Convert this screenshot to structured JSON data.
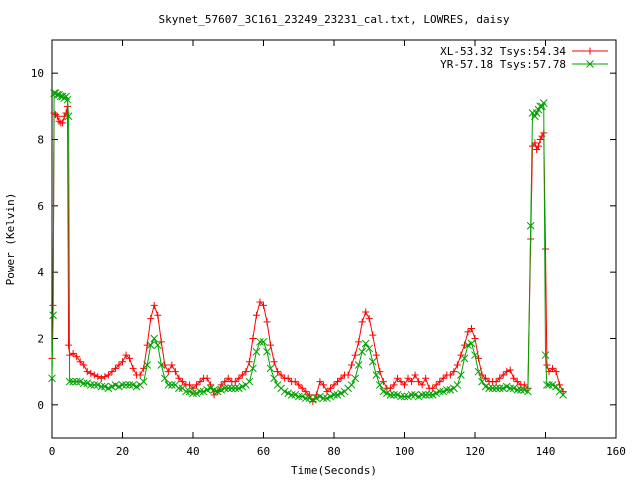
{
  "chart_data": {
    "type": "line",
    "title": "Skynet_57607_3C161_23249_23231_cal.txt, LOWRES, daisy",
    "xlabel": "Time(Seconds)",
    "ylabel": "Power (Kelvin)",
    "xlim": [
      0,
      160
    ],
    "ylim": [
      -1,
      11
    ],
    "xticks": [
      0,
      20,
      40,
      60,
      80,
      100,
      120,
      140,
      160
    ],
    "yticks": [
      0,
      2,
      4,
      6,
      8,
      10
    ],
    "grid": false,
    "legend_position": "top-right",
    "series": [
      {
        "name": "XL-53.32 Tsys:54.34",
        "color": "#ff0000",
        "marker": "plus",
        "points": [
          [
            0.0,
            1.4
          ],
          [
            0.3,
            3.0
          ],
          [
            0.6,
            8.8
          ],
          [
            1.0,
            8.75
          ],
          [
            1.5,
            8.7
          ],
          [
            2.0,
            8.55
          ],
          [
            2.5,
            8.5
          ],
          [
            3.0,
            8.5
          ],
          [
            3.5,
            8.7
          ],
          [
            4.0,
            8.8
          ],
          [
            4.4,
            9.0
          ],
          [
            4.7,
            1.8
          ],
          [
            5.0,
            1.5
          ],
          [
            6.0,
            1.55
          ],
          [
            7.0,
            1.45
          ],
          [
            8.0,
            1.3
          ],
          [
            9.0,
            1.2
          ],
          [
            10.0,
            1.0
          ],
          [
            11.0,
            0.95
          ],
          [
            12.0,
            0.9
          ],
          [
            13.0,
            0.85
          ],
          [
            14.0,
            0.8
          ],
          [
            15.0,
            0.85
          ],
          [
            16.0,
            0.9
          ],
          [
            17.0,
            1.0
          ],
          [
            18.0,
            1.1
          ],
          [
            19.0,
            1.2
          ],
          [
            20.0,
            1.3
          ],
          [
            21.0,
            1.5
          ],
          [
            22.0,
            1.4
          ],
          [
            23.0,
            1.1
          ],
          [
            24.0,
            0.9
          ],
          [
            25.0,
            0.9
          ],
          [
            26.0,
            1.1
          ],
          [
            27.0,
            1.8
          ],
          [
            28.0,
            2.6
          ],
          [
            29.0,
            3.0
          ],
          [
            30.0,
            2.7
          ],
          [
            31.0,
            1.9
          ],
          [
            32.0,
            1.2
          ],
          [
            33.0,
            1.0
          ],
          [
            34.0,
            1.2
          ],
          [
            35.0,
            1.0
          ],
          [
            36.0,
            0.8
          ],
          [
            37.0,
            0.7
          ],
          [
            38.0,
            0.6
          ],
          [
            39.0,
            0.6
          ],
          [
            40.0,
            0.5
          ],
          [
            41.0,
            0.6
          ],
          [
            42.0,
            0.7
          ],
          [
            43.0,
            0.8
          ],
          [
            44.0,
            0.8
          ],
          [
            45.0,
            0.6
          ],
          [
            46.0,
            0.3
          ],
          [
            47.0,
            0.4
          ],
          [
            48.0,
            0.6
          ],
          [
            49.0,
            0.7
          ],
          [
            50.0,
            0.8
          ],
          [
            51.0,
            0.7
          ],
          [
            52.0,
            0.7
          ],
          [
            53.0,
            0.8
          ],
          [
            54.0,
            0.9
          ],
          [
            55.0,
            1.0
          ],
          [
            56.0,
            1.3
          ],
          [
            57.0,
            2.0
          ],
          [
            58.0,
            2.7
          ],
          [
            59.0,
            3.1
          ],
          [
            60.0,
            3.0
          ],
          [
            61.0,
            2.5
          ],
          [
            62.0,
            1.8
          ],
          [
            63.0,
            1.3
          ],
          [
            64.0,
            1.0
          ],
          [
            65.0,
            0.9
          ],
          [
            66.0,
            0.8
          ],
          [
            67.0,
            0.8
          ],
          [
            68.0,
            0.7
          ],
          [
            69.0,
            0.7
          ],
          [
            70.0,
            0.6
          ],
          [
            71.0,
            0.5
          ],
          [
            72.0,
            0.4
          ],
          [
            73.0,
            0.3
          ],
          [
            74.0,
            0.1
          ],
          [
            75.0,
            0.3
          ],
          [
            76.0,
            0.7
          ],
          [
            77.0,
            0.6
          ],
          [
            78.0,
            0.4
          ],
          [
            79.0,
            0.5
          ],
          [
            80.0,
            0.6
          ],
          [
            81.0,
            0.7
          ],
          [
            82.0,
            0.8
          ],
          [
            83.0,
            0.9
          ],
          [
            84.0,
            0.9
          ],
          [
            85.0,
            1.2
          ],
          [
            86.0,
            1.5
          ],
          [
            87.0,
            1.9
          ],
          [
            88.0,
            2.5
          ],
          [
            89.0,
            2.8
          ],
          [
            90.0,
            2.6
          ],
          [
            91.0,
            2.1
          ],
          [
            92.0,
            1.5
          ],
          [
            93.0,
            1.0
          ],
          [
            94.0,
            0.7
          ],
          [
            95.0,
            0.5
          ],
          [
            96.0,
            0.5
          ],
          [
            97.0,
            0.6
          ],
          [
            98.0,
            0.8
          ],
          [
            99.0,
            0.7
          ],
          [
            100.0,
            0.6
          ],
          [
            101.0,
            0.8
          ],
          [
            102.0,
            0.7
          ],
          [
            103.0,
            0.9
          ],
          [
            104.0,
            0.7
          ],
          [
            105.0,
            0.6
          ],
          [
            106.0,
            0.8
          ],
          [
            107.0,
            0.5
          ],
          [
            108.0,
            0.5
          ],
          [
            109.0,
            0.6
          ],
          [
            110.0,
            0.7
          ],
          [
            111.0,
            0.8
          ],
          [
            112.0,
            0.9
          ],
          [
            113.0,
            0.9
          ],
          [
            114.0,
            1.0
          ],
          [
            115.0,
            1.2
          ],
          [
            116.0,
            1.5
          ],
          [
            117.0,
            1.8
          ],
          [
            118.0,
            2.2
          ],
          [
            119.0,
            2.3
          ],
          [
            120.0,
            2.0
          ],
          [
            121.0,
            1.4
          ],
          [
            122.0,
            0.9
          ],
          [
            123.0,
            0.8
          ],
          [
            124.0,
            0.7
          ],
          [
            125.0,
            0.7
          ],
          [
            126.0,
            0.7
          ],
          [
            127.0,
            0.8
          ],
          [
            128.0,
            0.9
          ],
          [
            129.0,
            1.0
          ],
          [
            130.0,
            1.05
          ],
          [
            131.0,
            0.8
          ],
          [
            132.0,
            0.7
          ],
          [
            133.0,
            0.6
          ],
          [
            134.0,
            0.6
          ],
          [
            135.0,
            0.5
          ],
          [
            135.8,
            5.0
          ],
          [
            136.3,
            7.8
          ],
          [
            137.0,
            7.9
          ],
          [
            137.5,
            7.7
          ],
          [
            138.0,
            7.8
          ],
          [
            138.5,
            8.0
          ],
          [
            139.0,
            8.1
          ],
          [
            139.5,
            8.2
          ],
          [
            140.0,
            4.7
          ],
          [
            140.4,
            1.2
          ],
          [
            141.0,
            1.0
          ],
          [
            142.0,
            1.1
          ],
          [
            143.0,
            1.0
          ],
          [
            144.0,
            0.6
          ],
          [
            145.0,
            0.4
          ]
        ]
      },
      {
        "name": "YR-57.18 Tsys:57.78",
        "color": "#00a000",
        "marker": "cross",
        "points": [
          [
            0.0,
            0.8
          ],
          [
            0.3,
            2.7
          ],
          [
            0.6,
            9.4
          ],
          [
            1.0,
            9.4
          ],
          [
            1.5,
            9.35
          ],
          [
            2.0,
            9.35
          ],
          [
            2.5,
            9.3
          ],
          [
            3.0,
            9.3
          ],
          [
            3.5,
            9.25
          ],
          [
            4.0,
            9.3
          ],
          [
            4.4,
            9.2
          ],
          [
            4.7,
            8.7
          ],
          [
            5.0,
            0.7
          ],
          [
            6.0,
            0.7
          ],
          [
            7.0,
            0.7
          ],
          [
            8.0,
            0.7
          ],
          [
            9.0,
            0.65
          ],
          [
            10.0,
            0.65
          ],
          [
            11.0,
            0.6
          ],
          [
            12.0,
            0.6
          ],
          [
            13.0,
            0.6
          ],
          [
            14.0,
            0.55
          ],
          [
            15.0,
            0.55
          ],
          [
            16.0,
            0.5
          ],
          [
            17.0,
            0.55
          ],
          [
            18.0,
            0.6
          ],
          [
            19.0,
            0.55
          ],
          [
            20.0,
            0.6
          ],
          [
            21.0,
            0.6
          ],
          [
            22.0,
            0.6
          ],
          [
            23.0,
            0.6
          ],
          [
            24.0,
            0.55
          ],
          [
            25.0,
            0.6
          ],
          [
            26.0,
            0.7
          ],
          [
            27.0,
            1.2
          ],
          [
            28.0,
            1.8
          ],
          [
            29.0,
            2.0
          ],
          [
            30.0,
            1.8
          ],
          [
            31.0,
            1.2
          ],
          [
            32.0,
            0.8
          ],
          [
            33.0,
            0.6
          ],
          [
            34.0,
            0.6
          ],
          [
            35.0,
            0.6
          ],
          [
            36.0,
            0.5
          ],
          [
            37.0,
            0.5
          ],
          [
            38.0,
            0.4
          ],
          [
            39.0,
            0.4
          ],
          [
            40.0,
            0.35
          ],
          [
            41.0,
            0.35
          ],
          [
            42.0,
            0.4
          ],
          [
            43.0,
            0.4
          ],
          [
            44.0,
            0.45
          ],
          [
            45.0,
            0.5
          ],
          [
            46.0,
            0.45
          ],
          [
            47.0,
            0.4
          ],
          [
            48.0,
            0.45
          ],
          [
            49.0,
            0.5
          ],
          [
            50.0,
            0.5
          ],
          [
            51.0,
            0.5
          ],
          [
            52.0,
            0.5
          ],
          [
            53.0,
            0.5
          ],
          [
            54.0,
            0.55
          ],
          [
            55.0,
            0.6
          ],
          [
            56.0,
            0.7
          ],
          [
            57.0,
            1.1
          ],
          [
            58.0,
            1.6
          ],
          [
            59.0,
            1.9
          ],
          [
            60.0,
            1.9
          ],
          [
            61.0,
            1.6
          ],
          [
            62.0,
            1.1
          ],
          [
            63.0,
            0.8
          ],
          [
            64.0,
            0.6
          ],
          [
            65.0,
            0.5
          ],
          [
            66.0,
            0.4
          ],
          [
            67.0,
            0.35
          ],
          [
            68.0,
            0.3
          ],
          [
            69.0,
            0.3
          ],
          [
            70.0,
            0.25
          ],
          [
            71.0,
            0.25
          ],
          [
            72.0,
            0.2
          ],
          [
            73.0,
            0.2
          ],
          [
            74.0,
            0.15
          ],
          [
            75.0,
            0.2
          ],
          [
            76.0,
            0.25
          ],
          [
            77.0,
            0.2
          ],
          [
            78.0,
            0.2
          ],
          [
            79.0,
            0.25
          ],
          [
            80.0,
            0.3
          ],
          [
            81.0,
            0.3
          ],
          [
            82.0,
            0.35
          ],
          [
            83.0,
            0.4
          ],
          [
            84.0,
            0.5
          ],
          [
            85.0,
            0.6
          ],
          [
            86.0,
            0.8
          ],
          [
            87.0,
            1.2
          ],
          [
            88.0,
            1.6
          ],
          [
            89.0,
            1.85
          ],
          [
            90.0,
            1.7
          ],
          [
            91.0,
            1.3
          ],
          [
            92.0,
            0.9
          ],
          [
            93.0,
            0.6
          ],
          [
            94.0,
            0.4
          ],
          [
            95.0,
            0.35
          ],
          [
            96.0,
            0.3
          ],
          [
            97.0,
            0.3
          ],
          [
            98.0,
            0.3
          ],
          [
            99.0,
            0.25
          ],
          [
            100.0,
            0.25
          ],
          [
            101.0,
            0.25
          ],
          [
            102.0,
            0.3
          ],
          [
            103.0,
            0.3
          ],
          [
            104.0,
            0.25
          ],
          [
            105.0,
            0.3
          ],
          [
            106.0,
            0.3
          ],
          [
            107.0,
            0.3
          ],
          [
            108.0,
            0.3
          ],
          [
            109.0,
            0.35
          ],
          [
            110.0,
            0.4
          ],
          [
            111.0,
            0.4
          ],
          [
            112.0,
            0.45
          ],
          [
            113.0,
            0.45
          ],
          [
            114.0,
            0.5
          ],
          [
            115.0,
            0.6
          ],
          [
            116.0,
            0.9
          ],
          [
            117.0,
            1.4
          ],
          [
            118.0,
            1.8
          ],
          [
            119.0,
            1.85
          ],
          [
            120.0,
            1.5
          ],
          [
            121.0,
            1.0
          ],
          [
            122.0,
            0.7
          ],
          [
            123.0,
            0.55
          ],
          [
            124.0,
            0.5
          ],
          [
            125.0,
            0.5
          ],
          [
            126.0,
            0.5
          ],
          [
            127.0,
            0.5
          ],
          [
            128.0,
            0.5
          ],
          [
            129.0,
            0.55
          ],
          [
            130.0,
            0.5
          ],
          [
            131.0,
            0.5
          ],
          [
            132.0,
            0.45
          ],
          [
            133.0,
            0.45
          ],
          [
            134.0,
            0.45
          ],
          [
            135.0,
            0.4
          ],
          [
            135.8,
            5.4
          ],
          [
            136.3,
            8.8
          ],
          [
            137.0,
            8.7
          ],
          [
            137.5,
            8.8
          ],
          [
            138.0,
            8.9
          ],
          [
            138.5,
            9.0
          ],
          [
            139.0,
            9.0
          ],
          [
            139.5,
            9.1
          ],
          [
            140.0,
            1.5
          ],
          [
            140.4,
            0.6
          ],
          [
            141.0,
            0.6
          ],
          [
            142.0,
            0.6
          ],
          [
            143.0,
            0.55
          ],
          [
            144.0,
            0.4
          ],
          [
            145.0,
            0.3
          ]
        ]
      }
    ]
  }
}
